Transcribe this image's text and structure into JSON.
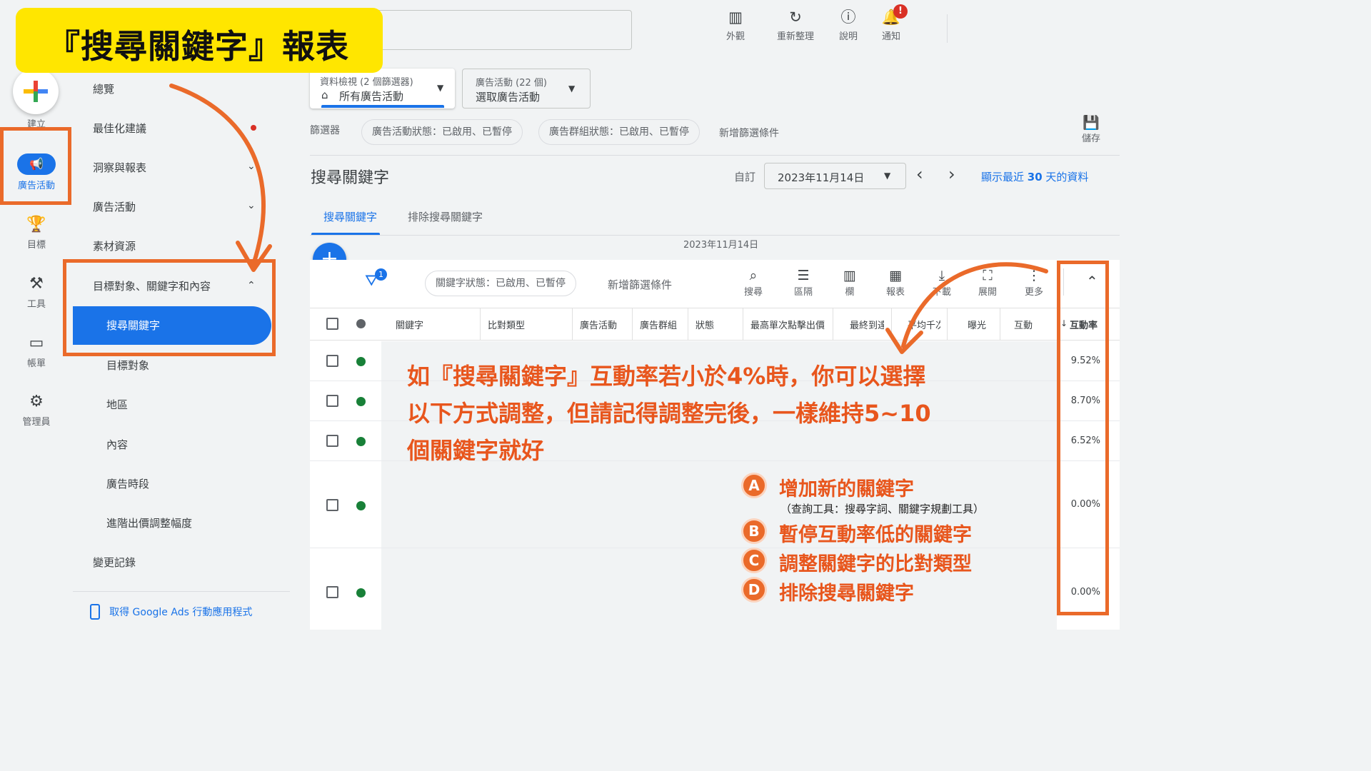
{
  "banner": {
    "title": "『搜尋關鍵字』報表"
  },
  "rail": {
    "create": "建立",
    "campaigns": "廣告活動",
    "goals": "目標",
    "tools": "工具",
    "billing": "帳單",
    "admin": "管理員"
  },
  "sidebar": {
    "items": [
      {
        "label": "總覽"
      },
      {
        "label": "最佳化建議"
      },
      {
        "label": "洞察與報表"
      },
      {
        "label": "廣告活動"
      },
      {
        "label": "素材資源"
      },
      {
        "label": "目標對象、關鍵字和內容"
      },
      {
        "label": "搜尋關鍵字"
      },
      {
        "label": "目標對象"
      },
      {
        "label": "地區"
      },
      {
        "label": "內容"
      },
      {
        "label": "廣告時段"
      },
      {
        "label": "進階出價調整幅度"
      },
      {
        "label": "變更記錄"
      }
    ],
    "app_link": "取得 Google Ads 行動應用程式"
  },
  "topbar": {
    "appearance": "外觀",
    "refresh": "重新整理",
    "help": "說明",
    "notifications": "通知",
    "notif_badge": "!"
  },
  "selectors": {
    "view_caption": "資料檢視 (2 個篩選器)",
    "view_value": "所有廣告活動",
    "campaign_caption": "廣告活動 (22 個)",
    "campaign_value": "選取廣告活動"
  },
  "filters": {
    "label": "篩選器",
    "chips": [
      "廣告活動狀態：已啟用、已暫停",
      "廣告群組狀態：已啟用、已暫停"
    ],
    "add": "新增篩選條件",
    "save": "儲存"
  },
  "page": {
    "title": "搜尋關鍵字",
    "custom": "自訂",
    "date": "2023年11月14日",
    "last30_prefix": "顯示最近 ",
    "last30_num": "30",
    "last30_suffix": " 天的資料",
    "tabs": [
      "搜尋關鍵字",
      "排除搜尋關鍵字"
    ],
    "chart_date": "2023年11月14日"
  },
  "table_toolbar": {
    "filter_badge": "1",
    "status_chip": "關鍵字狀態：已啟用、已暫停",
    "add_filter": "新增篩選條件",
    "buttons": [
      "搜尋",
      "區隔",
      "欄",
      "報表",
      "下載",
      "展開",
      "更多"
    ]
  },
  "table": {
    "headers": [
      "關鍵字",
      "比對類型",
      "廣告活動",
      "廣告群組",
      "狀態",
      "最高單次點擊出價",
      "最終到達網址",
      "平均千次曝光出價",
      "曝光",
      "互動",
      "互動率"
    ],
    "rows": [
      {
        "rate": "9.52%"
      },
      {
        "rate": "8.70%"
      },
      {
        "rate": "6.52%"
      },
      {
        "rate": "0.00%"
      },
      {
        "rate": "0.00%"
      }
    ]
  },
  "annotation": {
    "lines": [
      "如『搜尋關鍵字』互動率若小於4%時，你可以選擇",
      "以下方式調整，但請記得調整完後，一樣維持5~10",
      "個關鍵字就好"
    ],
    "options": [
      {
        "letter": "A",
        "text": "增加新的關鍵字"
      },
      {
        "letter": "B",
        "text": "暫停互動率低的關鍵字"
      },
      {
        "letter": "C",
        "text": "調整關鍵字的比對類型"
      },
      {
        "letter": "D",
        "text": "排除搜尋關鍵字"
      }
    ],
    "note": "（查詢工具：搜尋字詞、關鍵字規劃工具）"
  },
  "colors": {
    "accent": "#1a73e8",
    "annotation": "#e8561d",
    "banner": "#ffe600",
    "status_green": "#188038"
  }
}
